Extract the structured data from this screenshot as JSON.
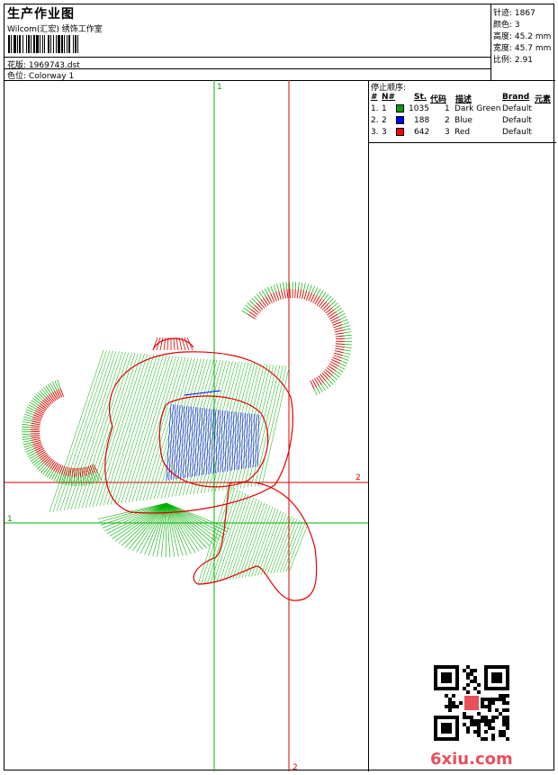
{
  "header": {
    "title": "生产作业图",
    "studio": "Wilcom(汇宏) 绣饰工作室",
    "design_label": "花版:",
    "design_value": "1969743.dst",
    "colorway_label": "色位:",
    "colorway_value": "Colorway 1"
  },
  "stats": [
    {
      "label": "针迹:",
      "value": "1867"
    },
    {
      "label": "颜色:",
      "value": "3"
    },
    {
      "label": "高度:",
      "value": "45.2 mm"
    },
    {
      "label": "宽度:",
      "value": "45.7 mm"
    },
    {
      "label": "比例:",
      "value": "2.91"
    }
  ],
  "stop_sequence": {
    "title": "停止顺序:",
    "columns": [
      "#",
      "N#",
      "St.",
      "代码",
      "描述",
      "Brand",
      "元素"
    ],
    "rows": [
      {
        "idx": "1.",
        "n": "1",
        "stitches": "1035",
        "code": "1",
        "desc": "Dark Green",
        "brand": "Default",
        "color": "#00a000"
      },
      {
        "idx": "2.",
        "n": "2",
        "stitches": "188",
        "code": "2",
        "desc": "Blue",
        "brand": "Default",
        "color": "#0000ff"
      },
      {
        "idx": "3.",
        "n": "3",
        "stitches": "642",
        "code": "3",
        "desc": "Red",
        "brand": "Default",
        "color": "#ff0000"
      }
    ]
  },
  "axis_labels": {
    "v_green": "1",
    "h_green": "1",
    "v_red": "2",
    "h_red": "2"
  },
  "logo": "6xiu.com",
  "colors": {
    "green": "#00b000",
    "red": "#e00000",
    "blue": "#0000ff"
  }
}
